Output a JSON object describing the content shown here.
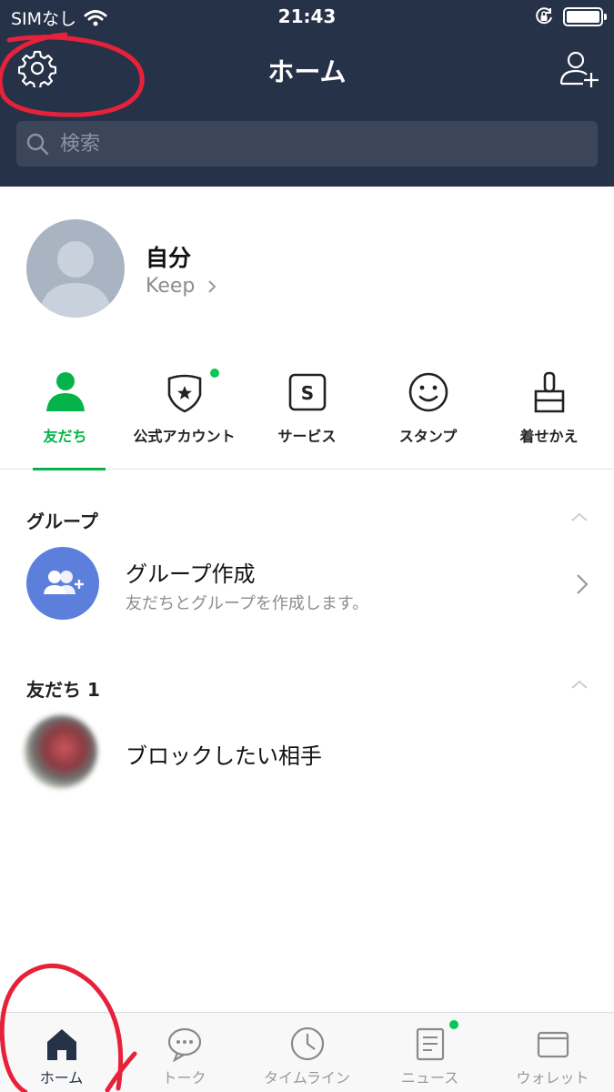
{
  "status_bar": {
    "carrier": "SIMなし",
    "time": "21:43"
  },
  "header": {
    "title": "ホーム"
  },
  "search": {
    "placeholder": "検索"
  },
  "profile": {
    "name": "自分",
    "keep_label": "Keep"
  },
  "categories": [
    {
      "label": "友だち",
      "icon": "person-icon",
      "active": true
    },
    {
      "label": "公式アカウント",
      "icon": "shield-star-icon",
      "badge": true
    },
    {
      "label": "サービス",
      "icon": "service-s-icon"
    },
    {
      "label": "スタンプ",
      "icon": "smiley-icon"
    },
    {
      "label": "着せかえ",
      "icon": "brush-icon"
    }
  ],
  "groups_section": {
    "title": "グループ",
    "create_title": "グループ作成",
    "create_subtitle": "友だちとグループを作成します。"
  },
  "friends_section": {
    "title": "友だち 1",
    "friends": [
      {
        "name": "ブロックしたい相手"
      }
    ]
  },
  "bottom_tabs": [
    {
      "label": "ホーム",
      "icon": "home-icon",
      "active": true
    },
    {
      "label": "トーク",
      "icon": "chat-bubble-icon"
    },
    {
      "label": "タイムライン",
      "icon": "clock-icon"
    },
    {
      "label": "ニュース",
      "icon": "news-icon",
      "badge": true
    },
    {
      "label": "ウォレット",
      "icon": "wallet-icon"
    }
  ],
  "colors": {
    "header_bg": "#263248",
    "accent_green": "#06b34a",
    "badge_green": "#06c755",
    "group_icon_bg": "#5d7fdc",
    "annotation_red": "#e8213a"
  }
}
